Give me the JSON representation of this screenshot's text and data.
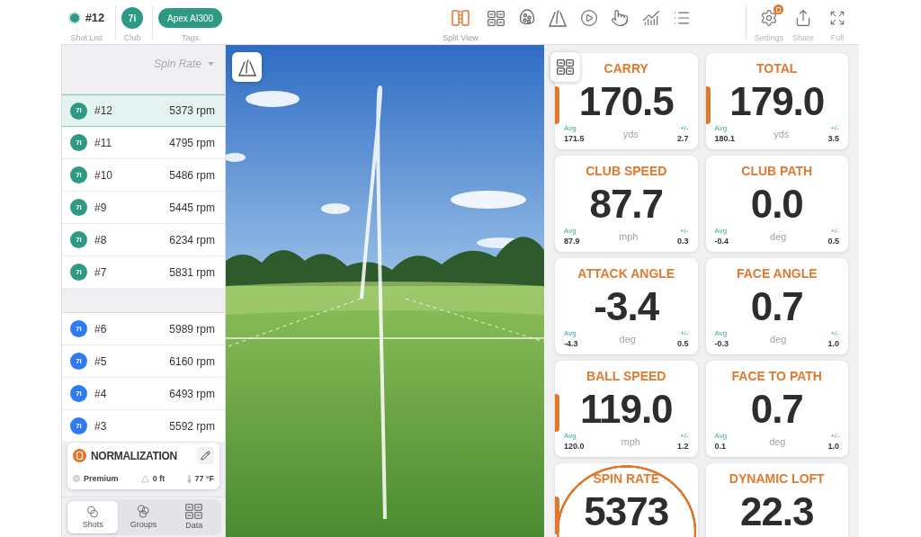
{
  "top_bar": {
    "shot": {
      "number": "#12",
      "label": "Shot List"
    },
    "club": {
      "name": "7i",
      "label": "Club"
    },
    "tag": {
      "name": "Apex AI300",
      "label": "Tags"
    },
    "views": [
      {
        "kind": "split",
        "label": "Split View",
        "selected": true
      },
      {
        "kind": "grid",
        "selected": false
      },
      {
        "kind": "dispersion",
        "selected": false
      },
      {
        "kind": "trajectory",
        "selected": false
      },
      {
        "kind": "play",
        "selected": false
      },
      {
        "kind": "touch",
        "selected": false
      },
      {
        "kind": "chart",
        "selected": false
      },
      {
        "kind": "list",
        "selected": false
      }
    ],
    "actions": [
      {
        "kind": "settings",
        "label": "Settings",
        "badge": true
      },
      {
        "kind": "share",
        "label": "Share",
        "badge": false
      },
      {
        "kind": "full",
        "label": "Full",
        "badge": false
      }
    ]
  },
  "shot_list": {
    "sort": "Spin Rate",
    "groups": [
      {
        "shots": [
          {
            "club": "7i",
            "number": "#12",
            "value": "5373 rpm",
            "color": "#2e9a84",
            "selected": true
          },
          {
            "club": "7i",
            "number": "#11",
            "value": "4795 rpm",
            "color": "#2e9a84",
            "selected": false
          },
          {
            "club": "7i",
            "number": "#10",
            "value": "5486 rpm",
            "color": "#2e9a84",
            "selected": false
          },
          {
            "club": "7i",
            "number": "#9",
            "value": "5445 rpm",
            "color": "#2e9a84",
            "selected": false
          },
          {
            "club": "7i",
            "number": "#8",
            "value": "6234 rpm",
            "color": "#2e9a84",
            "selected": false
          },
          {
            "club": "7i",
            "number": "#7",
            "value": "5831 rpm",
            "color": "#2e9a84",
            "selected": false
          }
        ]
      },
      {
        "shots": [
          {
            "club": "7i",
            "number": "#6",
            "value": "5989 rpm",
            "color": "#2f7bf0",
            "selected": false
          },
          {
            "club": "7i",
            "number": "#5",
            "value": "6160 rpm",
            "color": "#2f7bf0",
            "selected": false
          },
          {
            "club": "7i",
            "number": "#4",
            "value": "6493 rpm",
            "color": "#2f7bf0",
            "selected": false
          },
          {
            "club": "7i",
            "number": "#3",
            "value": "5592 rpm",
            "color": "#2f7bf0",
            "selected": false
          }
        ]
      }
    ]
  },
  "normalization": {
    "title": "NORMALIZATION",
    "ball": "Premium",
    "altitude": "0 ft",
    "temperature": "77 °F"
  },
  "bottom_tabs": [
    {
      "kind": "shots",
      "label": "Shots",
      "selected": true
    },
    {
      "kind": "groups",
      "label": "Groups",
      "selected": false
    },
    {
      "kind": "data",
      "label": "Data",
      "selected": false
    }
  ],
  "tiles": [
    {
      "title": "CARRY",
      "value": "170.5",
      "unit": "yds",
      "avg_label": "Avg",
      "avg": "171.5",
      "spread_label": "+/-",
      "spread": "2.7",
      "normalized": true,
      "highlighted": false
    },
    {
      "title": "TOTAL",
      "value": "179.0",
      "unit": "yds",
      "avg_label": "Avg",
      "avg": "180.1",
      "spread_label": "+/-",
      "spread": "3.5",
      "normalized": true,
      "highlighted": false
    },
    {
      "title": "CLUB SPEED",
      "value": "87.7",
      "unit": "mph",
      "avg_label": "Avg",
      "avg": "87.9",
      "spread_label": "+/-",
      "spread": "0.3",
      "normalized": false,
      "highlighted": false
    },
    {
      "title": "CLUB PATH",
      "value": "0.0",
      "unit": "deg",
      "avg_label": "Avg",
      "avg": "-0.4",
      "spread_label": "+/-",
      "spread": "0.5",
      "normalized": false,
      "highlighted": false
    },
    {
      "title": "ATTACK ANGLE",
      "value": "-3.4",
      "unit": "deg",
      "avg_label": "Avg",
      "avg": "-4.3",
      "spread_label": "+/-",
      "spread": "0.5",
      "normalized": false,
      "highlighted": false
    },
    {
      "title": "FACE ANGLE",
      "value": "0.7",
      "unit": "deg",
      "avg_label": "Avg",
      "avg": "-0.3",
      "spread_label": "+/-",
      "spread": "1.0",
      "normalized": false,
      "highlighted": false
    },
    {
      "title": "BALL SPEED",
      "value": "119.0",
      "unit": "mph",
      "avg_label": "Avg",
      "avg": "120.0",
      "spread_label": "+/-",
      "spread": "1.2",
      "normalized": true,
      "highlighted": false
    },
    {
      "title": "FACE TO PATH",
      "value": "0.7",
      "unit": "deg",
      "avg_label": "Avg",
      "avg": "0.1",
      "spread_label": "+/-",
      "spread": "1.0",
      "normalized": false,
      "highlighted": false
    },
    {
      "title": "SPIN RATE",
      "value": "5373",
      "normalized": true,
      "highlighted": true
    },
    {
      "title": "DYNAMIC LOFT",
      "value": "22.3",
      "normalized": false,
      "highlighted": false
    }
  ]
}
